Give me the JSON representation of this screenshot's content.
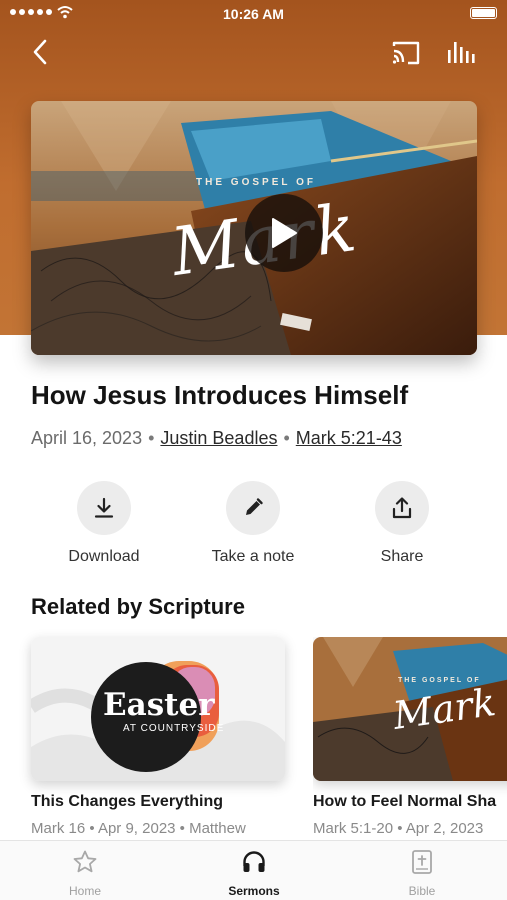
{
  "status_bar": {
    "time": "10:26 AM"
  },
  "header": {
    "back_icon": "chevron-left-icon",
    "cast_icon": "cast-icon",
    "audio_icon": "audio-bars-icon"
  },
  "video": {
    "series_subtitle": "THE GOSPEL OF",
    "series_title": "Mark",
    "play_icon": "play-icon"
  },
  "sermon": {
    "title": "How Jesus Introduces Himself",
    "date": "April 16, 2023",
    "speaker": "Justin Beadles",
    "scripture": "Mark 5:21-43",
    "separator": "•"
  },
  "actions": [
    {
      "label": "Download",
      "icon": "download-icon"
    },
    {
      "label": "Take a note",
      "icon": "pencil-icon"
    },
    {
      "label": "Share",
      "icon": "share-icon"
    }
  ],
  "related": {
    "heading": "Related by Scripture",
    "items": [
      {
        "title": "This Changes Everything",
        "meta": "Mark 16 • Apr 9, 2023 • Matthew",
        "art_title": "Easter",
        "art_subtitle": "AT COUNTRYSIDE"
      },
      {
        "title": "How to Feel Normal Sha",
        "meta": "Mark 5:1-20 • Apr 2, 2023",
        "art_subtitle": "THE GOSPEL OF",
        "art_title": "Mark"
      }
    ]
  },
  "tabs": [
    {
      "label": "Home",
      "icon": "star-icon",
      "active": false
    },
    {
      "label": "Sermons",
      "icon": "headphones-icon",
      "active": true
    },
    {
      "label": "Bible",
      "icon": "bible-icon",
      "active": false
    }
  ],
  "colors": {
    "hero": "#b8642a",
    "accent": "#1a1a1a",
    "inactive": "#a0a0a0"
  }
}
